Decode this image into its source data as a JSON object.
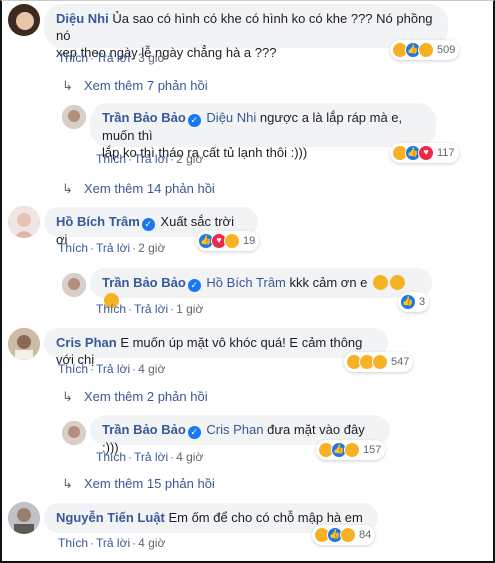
{
  "comments": [
    {
      "author": "Diệu Nhi",
      "text_line1": "Ủa sao có hình có khe có hình ko có khe ??? Nó phồng nó",
      "text_line2": "xẹp theo ngày lễ ngày chẳng hà a ???",
      "reaction_count": "509",
      "like_label": "Thích",
      "reply_label": "Trả lời",
      "time": "3 giờ"
    },
    {
      "author": "Trần Bảo Bảo",
      "mention": "Diệu Nhi",
      "text_line1": "ngược a là lắp ráp mà e, muốn thì",
      "text_line2": "lắp ko thì tháo ra cất tủ lạnh thôi :)))",
      "reaction_count": "117",
      "like_label": "Thích",
      "reply_label": "Trả lời",
      "time": "2 giờ"
    },
    {
      "author": "Hồ Bích Trâm",
      "text": "Xuất sắc trời ơi",
      "reaction_count": "19",
      "like_label": "Thích",
      "reply_label": "Trả lời",
      "time": "2 giờ"
    },
    {
      "author": "Trần Bảo Bảo",
      "mention": "Hồ Bích Trâm",
      "text": "kkk cảm ơn e",
      "reaction_count": "3",
      "like_label": "Thích",
      "reply_label": "Trả lời",
      "time": "1 giờ"
    },
    {
      "author": "Cris Phan",
      "text": "E muốn úp mặt vô khóc quá! E cảm thông với chị",
      "reaction_count": "547",
      "like_label": "Thích",
      "reply_label": "Trả lời",
      "time": "4 giờ"
    },
    {
      "author": "Trần Bảo Bảo",
      "mention": "Cris Phan",
      "text": "đưa mặt vào đây :)))",
      "reaction_count": "157",
      "like_label": "Thích",
      "reply_label": "Trả lời",
      "time": "4 giờ"
    },
    {
      "author": "Nguyễn Tiến Luật",
      "text": "Em ốm để cho có chỗ mập hà em",
      "reaction_count": "84",
      "like_label": "Thích",
      "reply_label": "Trả lời",
      "time": "4 giờ"
    }
  ],
  "more_replies": [
    "Xem thêm 7 phản hồi",
    "Xem thêm 14 phản hồi",
    "Xem thêm 2 phản hồi",
    "Xem thêm 15 phản hồi"
  ],
  "separator": "·",
  "colors": {
    "link": "#385898",
    "bubble": "#f2f3f5",
    "like": "#1877f2",
    "haha": "#f7b125",
    "love": "#f0284a"
  }
}
